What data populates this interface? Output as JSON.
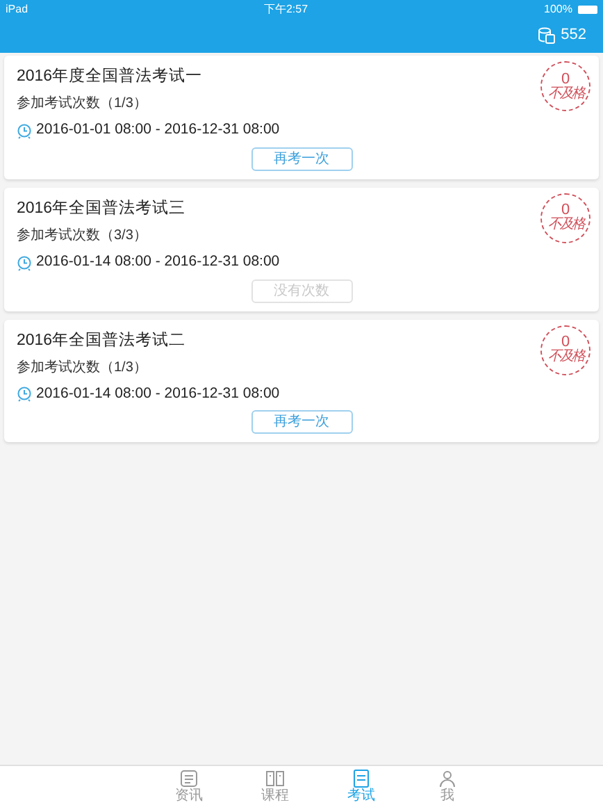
{
  "status_bar": {
    "device": "iPad",
    "time": "下午2:57",
    "battery": "100%"
  },
  "header": {
    "points": "552"
  },
  "exams": [
    {
      "title": "2016年度全国普法考试一",
      "attempts": "参加考试次数（1/3）",
      "period": "2016-01-01 08:00 - 2016-12-31 08:00",
      "button": "再考一次",
      "disabled": false,
      "score": "0",
      "result": "不及格"
    },
    {
      "title": "2016年全国普法考试三",
      "attempts": "参加考试次数（3/3）",
      "period": "2016-01-14 08:00 - 2016-12-31 08:00",
      "button": "没有次数",
      "disabled": true,
      "score": "0",
      "result": "不及格"
    },
    {
      "title": "2016年全国普法考试二",
      "attempts": "参加考试次数（1/3）",
      "period": "2016-01-14 08:00 - 2016-12-31 08:00",
      "button": "再考一次",
      "disabled": false,
      "score": "0",
      "result": "不及格"
    }
  ],
  "tab_bar": [
    {
      "label": "资讯",
      "kind": "news",
      "selected": false
    },
    {
      "label": "课程",
      "kind": "course",
      "selected": false
    },
    {
      "label": "考试",
      "kind": "exam",
      "selected": true
    },
    {
      "label": "我",
      "kind": "me",
      "selected": false
    }
  ]
}
